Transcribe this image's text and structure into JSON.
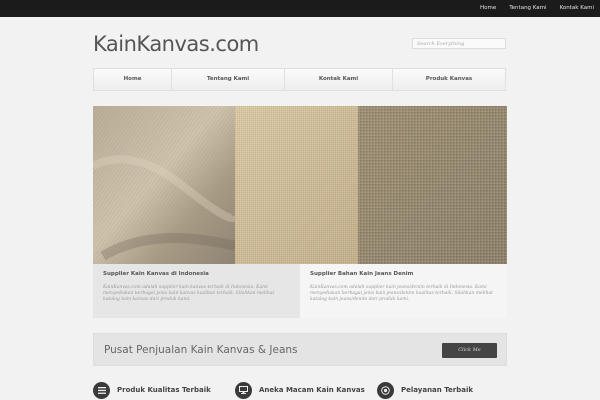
{
  "topnav": {
    "items": [
      "Home",
      "Tentang Kami",
      "Kontak Kami"
    ]
  },
  "header": {
    "logo": "KainKanvas.com",
    "search_placeholder": "Search Everything"
  },
  "mainnav": {
    "items": [
      "Home",
      "Tentang Kami",
      "Kontak Kami",
      "Produk Kanvas"
    ]
  },
  "features": [
    {
      "title": "Supplier Kain Kanvas di Indonesia",
      "body": "KainKanvas.com adalah supplier kain kanvas terbaik di Indonesia. Kami menyediakan berbagai jenis kain kanvas kualitas terbaik. Silahkan melihat katalog kain kanvas dari produk kami."
    },
    {
      "title": "Supplier Bahan Kain Jeans Denim",
      "body": "KainKanvas.com adalah supplier kain jeans/denim terbaik di Indonesia. Kami menyediakan berbagai jenis kain jeans/denim kualitas terbaik. Silahkan melihat katalog kain jeans/denim dari produk kami."
    }
  ],
  "cta": {
    "text": "Pusat Penjualan Kain Kanvas & Jeans",
    "button": "Click Me"
  },
  "services": [
    {
      "label": "Produk Kualitas Terbaik",
      "icon": "list-icon"
    },
    {
      "label": "Aneka Macam Kain Kanvas",
      "icon": "monitor-icon"
    },
    {
      "label": "Pelayanan Terbaik",
      "icon": "target-icon"
    }
  ]
}
